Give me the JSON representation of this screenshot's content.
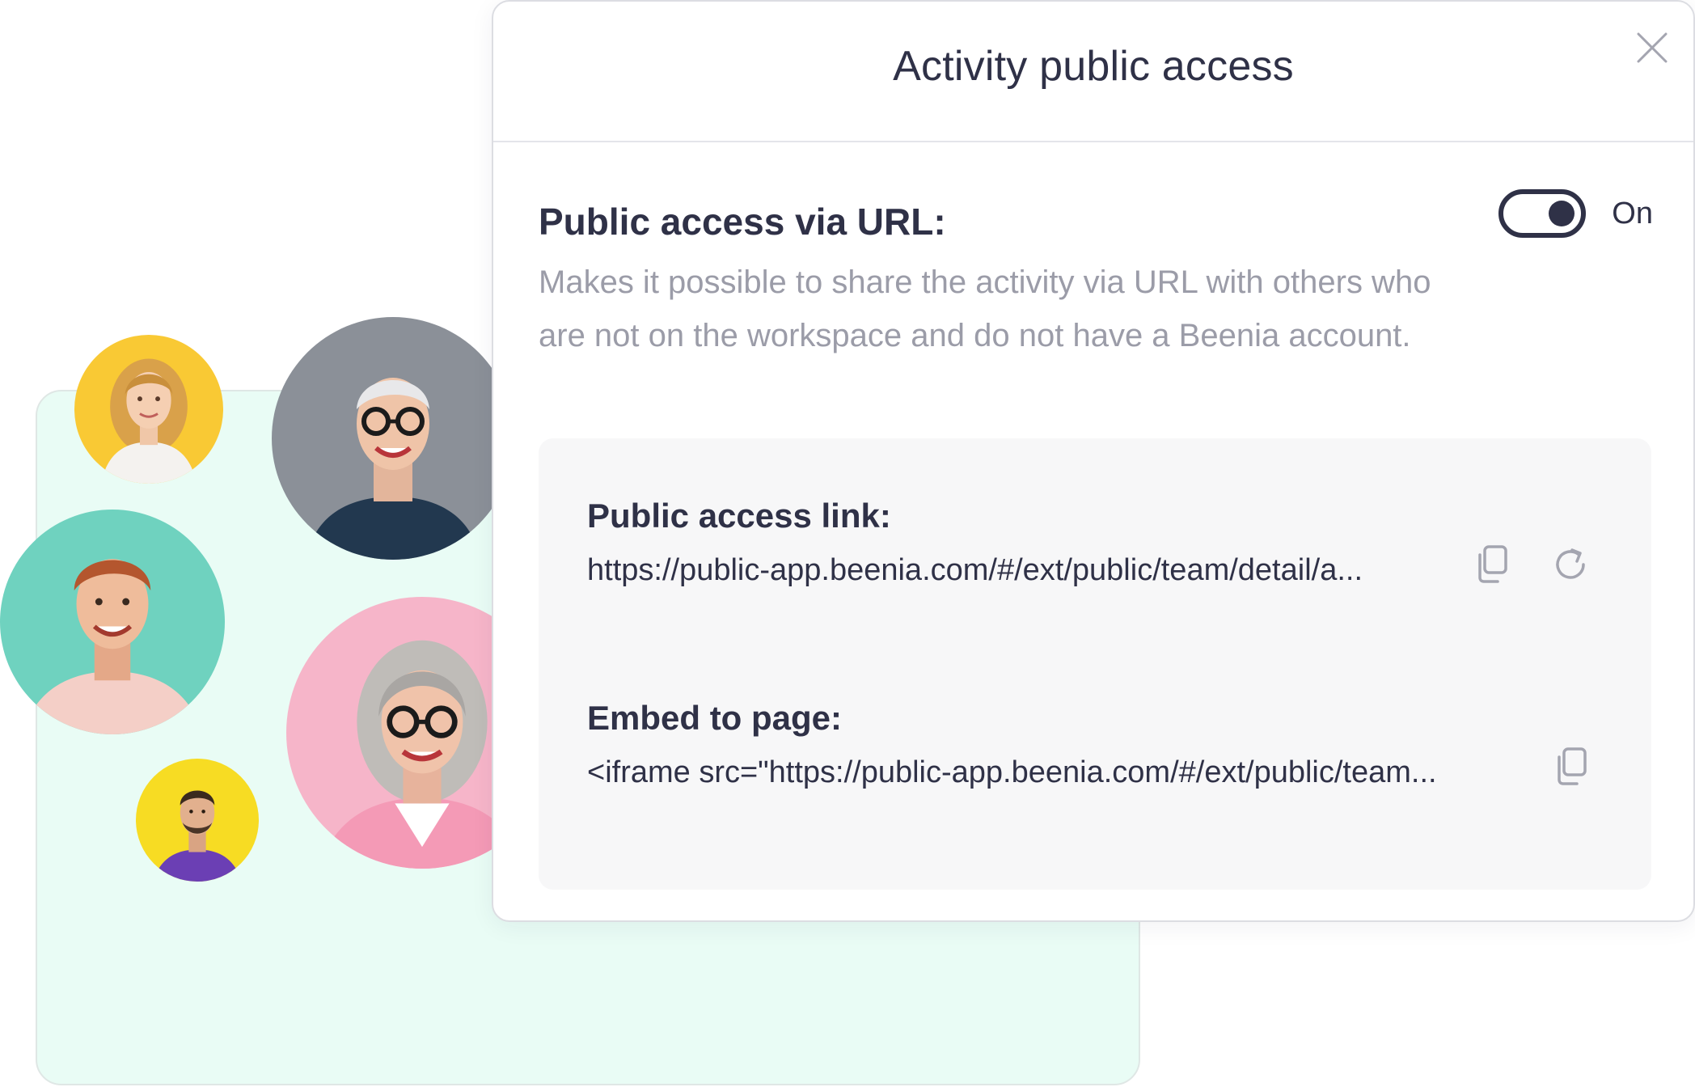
{
  "modal": {
    "title": "Activity public access",
    "close_icon": "close-icon"
  },
  "public_access": {
    "heading": "Public access via URL:",
    "description": "Makes it possible to share the activity via URL with others who are not on the workspace and do not have a Beenia account.",
    "toggle_state": "On"
  },
  "link": {
    "label": "Public access link:",
    "value": "https://public-app.beenia.com/#/ext/public/team/detail/a...",
    "copy_icon": "copy-icon",
    "regenerate_icon": "refresh-icon"
  },
  "embed": {
    "label": "Embed to page:",
    "value": "<iframe src=\"https://public-app.beenia.com/#/ext/public/team...",
    "copy_icon": "copy-icon"
  },
  "colors": {
    "text_primary": "#2f3147",
    "text_muted": "#9b9ca8",
    "panel_bg": "#f7f7f8",
    "mint_bg": "#e9fcf5"
  }
}
